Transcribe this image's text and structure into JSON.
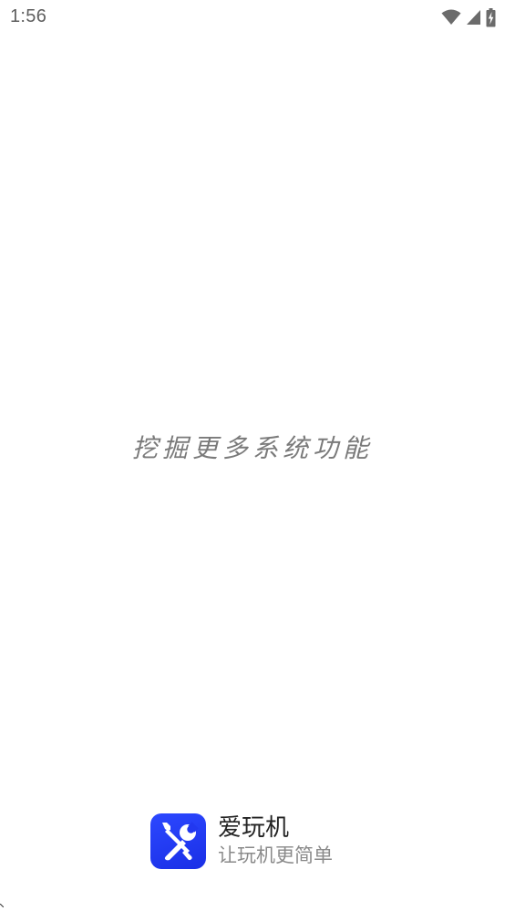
{
  "status_bar": {
    "time": "1:56",
    "icons": [
      "wifi-icon",
      "cell-signal-icon",
      "battery-charging-icon"
    ]
  },
  "splash": {
    "slogan": "挖掘更多系统功能"
  },
  "brand": {
    "icon": "tools-icon",
    "icon_color": "#2238f0",
    "app_name": "爱玩机",
    "tagline": "让玩机更简单"
  }
}
